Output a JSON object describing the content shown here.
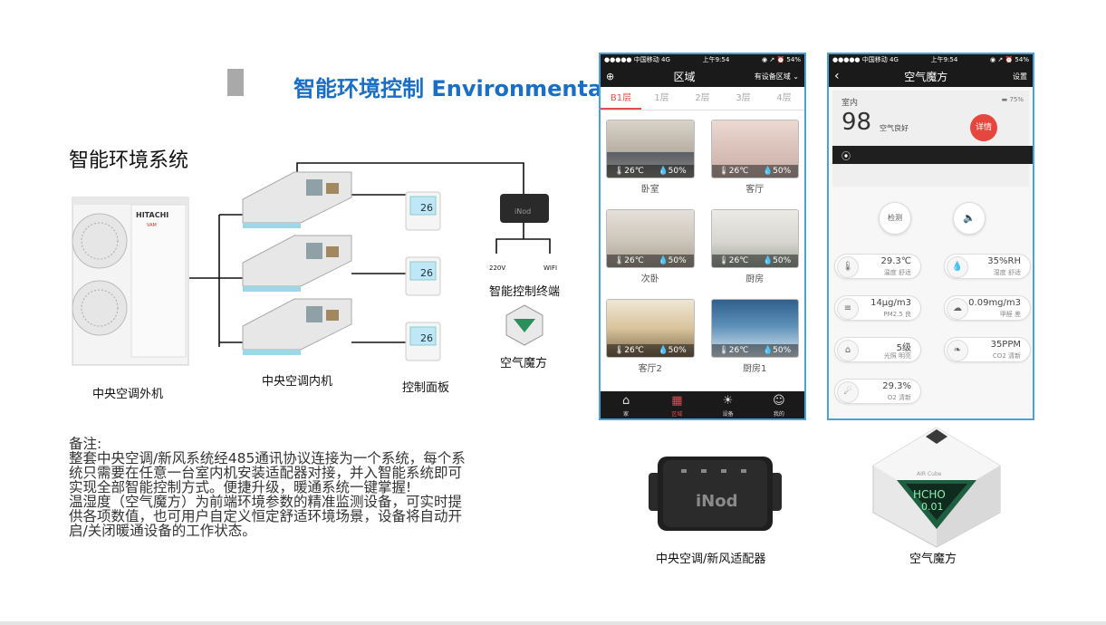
{
  "header": {
    "title": "智能环境控制 Environmental"
  },
  "diagram": {
    "subtitle": "智能环境系统",
    "outdoor_unit_label": "中央空调外机",
    "outdoor_brand": "HITACHI",
    "outdoor_model": "VAM",
    "indoor_unit_label": "中央空调内机",
    "panel_label": "控制面板",
    "panel_temp": "26",
    "terminal_label": "智能控制终端",
    "terminal_brand": "iNod",
    "power_label": "220V",
    "wifi_label": "WIFI",
    "cube_label": "空气魔方"
  },
  "notes": {
    "heading": "备注:",
    "line1": "整套中央空调/新风系统经485通讯协议连接为一个系统，每个系",
    "line2": "统只需要在任意一台室内机安装适配器对接，并入智能系统即可",
    "line3": "实现全部智能控制方式。便捷升级，暖通系统一键掌握!",
    "line4": "温湿度（空气魔方）为前端环境参数的精准监测设备，可实时提",
    "line5": "供各项数值，也可用户自定义恒定舒适环境场景，设备将自动开",
    "line6": "启/关闭暖通设备的工作状态。"
  },
  "phone1": {
    "status_carrier": "●●●●● 中国移动  4G",
    "status_time": "上午9:54",
    "status_battery": "◉ ↗ ⏰ 54%",
    "nav_add_icon": "⊕",
    "nav_title": "区域",
    "nav_filter": "有设备区域",
    "tabs": [
      "B1层",
      "1层",
      "2层",
      "3层",
      "4层"
    ],
    "rooms": [
      {
        "name": "卧室",
        "temp": "🌡26℃",
        "hum": "💧50%"
      },
      {
        "name": "客厅",
        "temp": "🌡26℃",
        "hum": "💧50%"
      },
      {
        "name": "次卧",
        "temp": "🌡26℃",
        "hum": "💧50%"
      },
      {
        "name": "厨房",
        "temp": "🌡26℃",
        "hum": "💧50%"
      },
      {
        "name": "客厅2",
        "temp": "🌡26℃",
        "hum": "💧50%"
      },
      {
        "name": "厨房1",
        "temp": "🌡26℃",
        "hum": "💧50%"
      }
    ],
    "bottom": [
      "家",
      "区域",
      "设备",
      "我的"
    ]
  },
  "phone2": {
    "status_carrier": "●●●●● 中国移动  4G",
    "status_time": "上午9:54",
    "status_battery": "◉ ↗ ⏰ 54%",
    "nav_title": "空气魔方",
    "nav_right": "设置",
    "card_label": "室内",
    "card_battery": "75%",
    "aqi_value": "98",
    "aqi_text": "空气良好",
    "detail_btn": "详情",
    "detect_btn": "检测",
    "metrics": [
      {
        "value": "29.3℃",
        "label": "温度 舒适"
      },
      {
        "value": "35%RH",
        "label": "湿度 舒适"
      },
      {
        "value": "14μg/m3",
        "label": "PM2.5 良"
      },
      {
        "value": "0.09mg/m3",
        "label": "甲醛 差"
      },
      {
        "value": "5级",
        "label": "光照 明亮"
      },
      {
        "value": "35PPM",
        "label": "CO2 清新"
      },
      {
        "value": "29.3%",
        "label": "O2 清新"
      }
    ]
  },
  "products": {
    "adapter_brand": "iNod",
    "adapter_label": "中央空调/新风适配器",
    "cube_display_top": "HCHO",
    "cube_display_bottom": "0.01",
    "cube_brand": "AIR Cube",
    "cube_label": "空气魔方"
  }
}
